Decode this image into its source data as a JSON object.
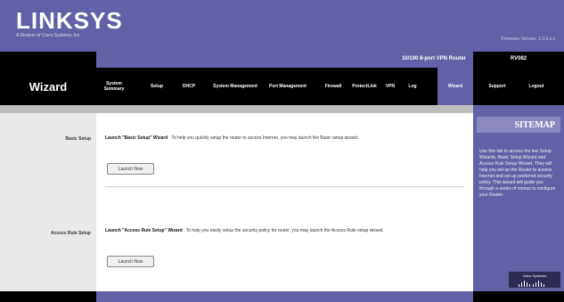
{
  "header": {
    "logo": "LINKSYS",
    "logo_sub": "A Division of Cisco Systems, Inc.",
    "firmware": "Firmware Version: 1.0.0.x.x"
  },
  "product": {
    "name": "10/100 8-port VPN Router",
    "model": "RV082"
  },
  "nav": {
    "section_title": "Wizard",
    "tabs": [
      {
        "label": "System Summary"
      },
      {
        "label": "Setup"
      },
      {
        "label": "DHCP"
      },
      {
        "label": "System Management"
      },
      {
        "label": "Port Management"
      },
      {
        "label": "Firewall"
      },
      {
        "label": "ProtectLink"
      },
      {
        "label": "VPN"
      },
      {
        "label": "Log"
      },
      {
        "label": "Wizard"
      },
      {
        "label": "Support"
      },
      {
        "label": "Logout"
      }
    ]
  },
  "main": {
    "basic": {
      "label": "Basic Setup",
      "title": "Launch \"Basic Setup\" Wizard",
      "desc": " : To help you quickly setup the router to access Internet, you may launch the Basic setup wizard.",
      "button": "Launch Now"
    },
    "access": {
      "label": "Access Rule Setup",
      "title": "Launch \"Access Rule Setup\" Wizard",
      "desc": " : To help you easily setup the security policy for router, you may launch the Access Rule setup wizard.",
      "button": "Launch Now"
    }
  },
  "sidebar": {
    "heading": "SITEMAP",
    "text": "Use this tab to access the two Setup Wizards, Basic Setup Wizard and Access Rule Setup Wizard. They will help you set up the Router to access Internet and set up preferred security policy. This wizard will guide you through a series of menus to configure your Router.",
    "brand": "Cisco Systems"
  },
  "colors": {
    "brand": "#6260a6",
    "nav_bg": "#000000",
    "strip": "#bdbdbd"
  }
}
